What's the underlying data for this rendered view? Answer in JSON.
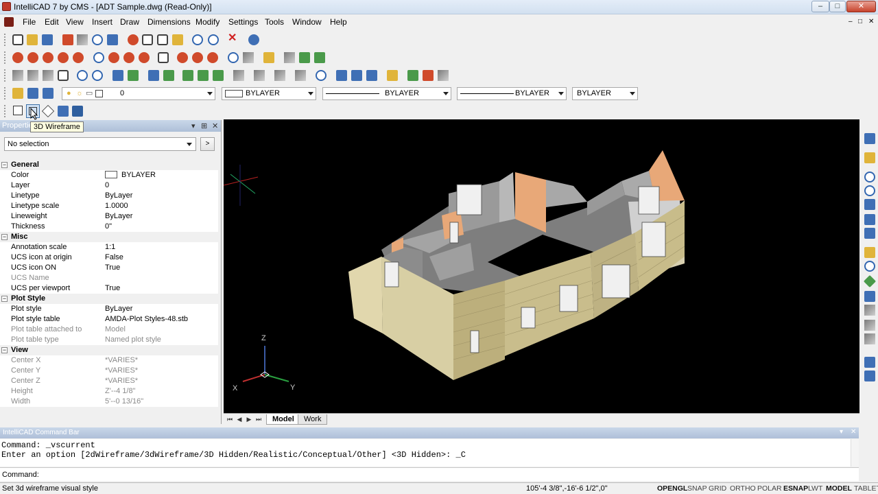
{
  "window": {
    "title": "IntelliCAD 7 by CMS - [ADT Sample.dwg (Read-Only)]",
    "minimize": "–",
    "maximize": "□",
    "close": "✕",
    "mdi_controls": [
      "–",
      "□",
      "✕"
    ]
  },
  "menu": [
    "File",
    "Edit",
    "View",
    "Insert",
    "Draw",
    "Dimensions",
    "Modify",
    "Settings",
    "Tools",
    "Window",
    "Help"
  ],
  "layer_toolbar": {
    "layer_value": "0",
    "color_value": "BYLAYER",
    "linetype_value": "BYLAYER",
    "lineweight_value": "BYLAYER",
    "plotstyle_value": "BYLAYER"
  },
  "tooltip": "3D Wireframe",
  "properties_panel": {
    "title": "Properties",
    "selection": "No selection",
    "select_button": ">",
    "categories": [
      {
        "name": "General",
        "rows": [
          {
            "key": "Color",
            "value": "BYLAYER",
            "swatch": true,
            "disabled": false
          },
          {
            "key": "Layer",
            "value": "0",
            "disabled": false
          },
          {
            "key": "Linetype",
            "value": "ByLayer",
            "disabled": false
          },
          {
            "key": "Linetype scale",
            "value": "1.0000",
            "disabled": false
          },
          {
            "key": "Lineweight",
            "value": "ByLayer",
            "disabled": false
          },
          {
            "key": "Thickness",
            "value": "0\"",
            "disabled": false
          }
        ]
      },
      {
        "name": "Misc",
        "rows": [
          {
            "key": "Annotation scale",
            "value": "1:1",
            "disabled": false
          },
          {
            "key": "UCS icon at origin",
            "value": "False",
            "disabled": false
          },
          {
            "key": "UCS icon ON",
            "value": "True",
            "disabled": false
          },
          {
            "key": "UCS Name",
            "value": "",
            "disabled": true
          },
          {
            "key": "UCS per viewport",
            "value": "True",
            "disabled": false
          }
        ]
      },
      {
        "name": "Plot Style",
        "rows": [
          {
            "key": "Plot style",
            "value": "ByLayer",
            "disabled": false
          },
          {
            "key": "Plot style table",
            "value": "AMDA-Plot Styles-48.stb",
            "disabled": false
          },
          {
            "key": "Plot table attached to",
            "value": "Model",
            "disabled": true
          },
          {
            "key": "Plot table type",
            "value": "Named plot style",
            "disabled": true
          }
        ]
      },
      {
        "name": "View",
        "rows": [
          {
            "key": "Center X",
            "value": "*VARIES*",
            "disabled": true
          },
          {
            "key": "Center Y",
            "value": "*VARIES*",
            "disabled": true
          },
          {
            "key": "Center Z",
            "value": "*VARIES*",
            "disabled": true
          },
          {
            "key": "Height",
            "value": "Z'--4 1/8\"",
            "disabled": true
          },
          {
            "key": "Width",
            "value": "5'--0 13/16\"",
            "disabled": true
          }
        ]
      }
    ]
  },
  "viewport": {
    "axis_labels": {
      "z": "Z",
      "x": "X",
      "y": "Y"
    },
    "colors": {
      "background": "#000000",
      "wall": "#d8d0b0",
      "interior": "#9c9c9c",
      "accent_roof": "#e8a878"
    }
  },
  "layout_tabs": [
    "Model",
    "Work"
  ],
  "command_bar": {
    "title": "IntelliCAD Command Bar",
    "history": [
      "Command: _vscurrent",
      "Enter an option [2dWireframe/3dWireframe/3D Hidden/Realistic/Conceptual/Other] <3D Hidden>: _C"
    ],
    "prompt": "Command:"
  },
  "status_bar": {
    "message": "Set 3d wireframe visual style",
    "coordinates": "105'-4 3/8\",-16'-6 1/2\",0\"",
    "toggles": [
      {
        "label": "OPENGL",
        "on": true
      },
      {
        "label": "SNAP",
        "on": false
      },
      {
        "label": "GRID",
        "on": false
      },
      {
        "label": "ORTHO",
        "on": false
      },
      {
        "label": "POLAR",
        "on": false
      },
      {
        "label": "ESNAP",
        "on": true
      },
      {
        "label": "LWT",
        "on": false
      },
      {
        "label": "MODEL",
        "on": true
      },
      {
        "label": "TABLET",
        "on": false
      }
    ]
  }
}
